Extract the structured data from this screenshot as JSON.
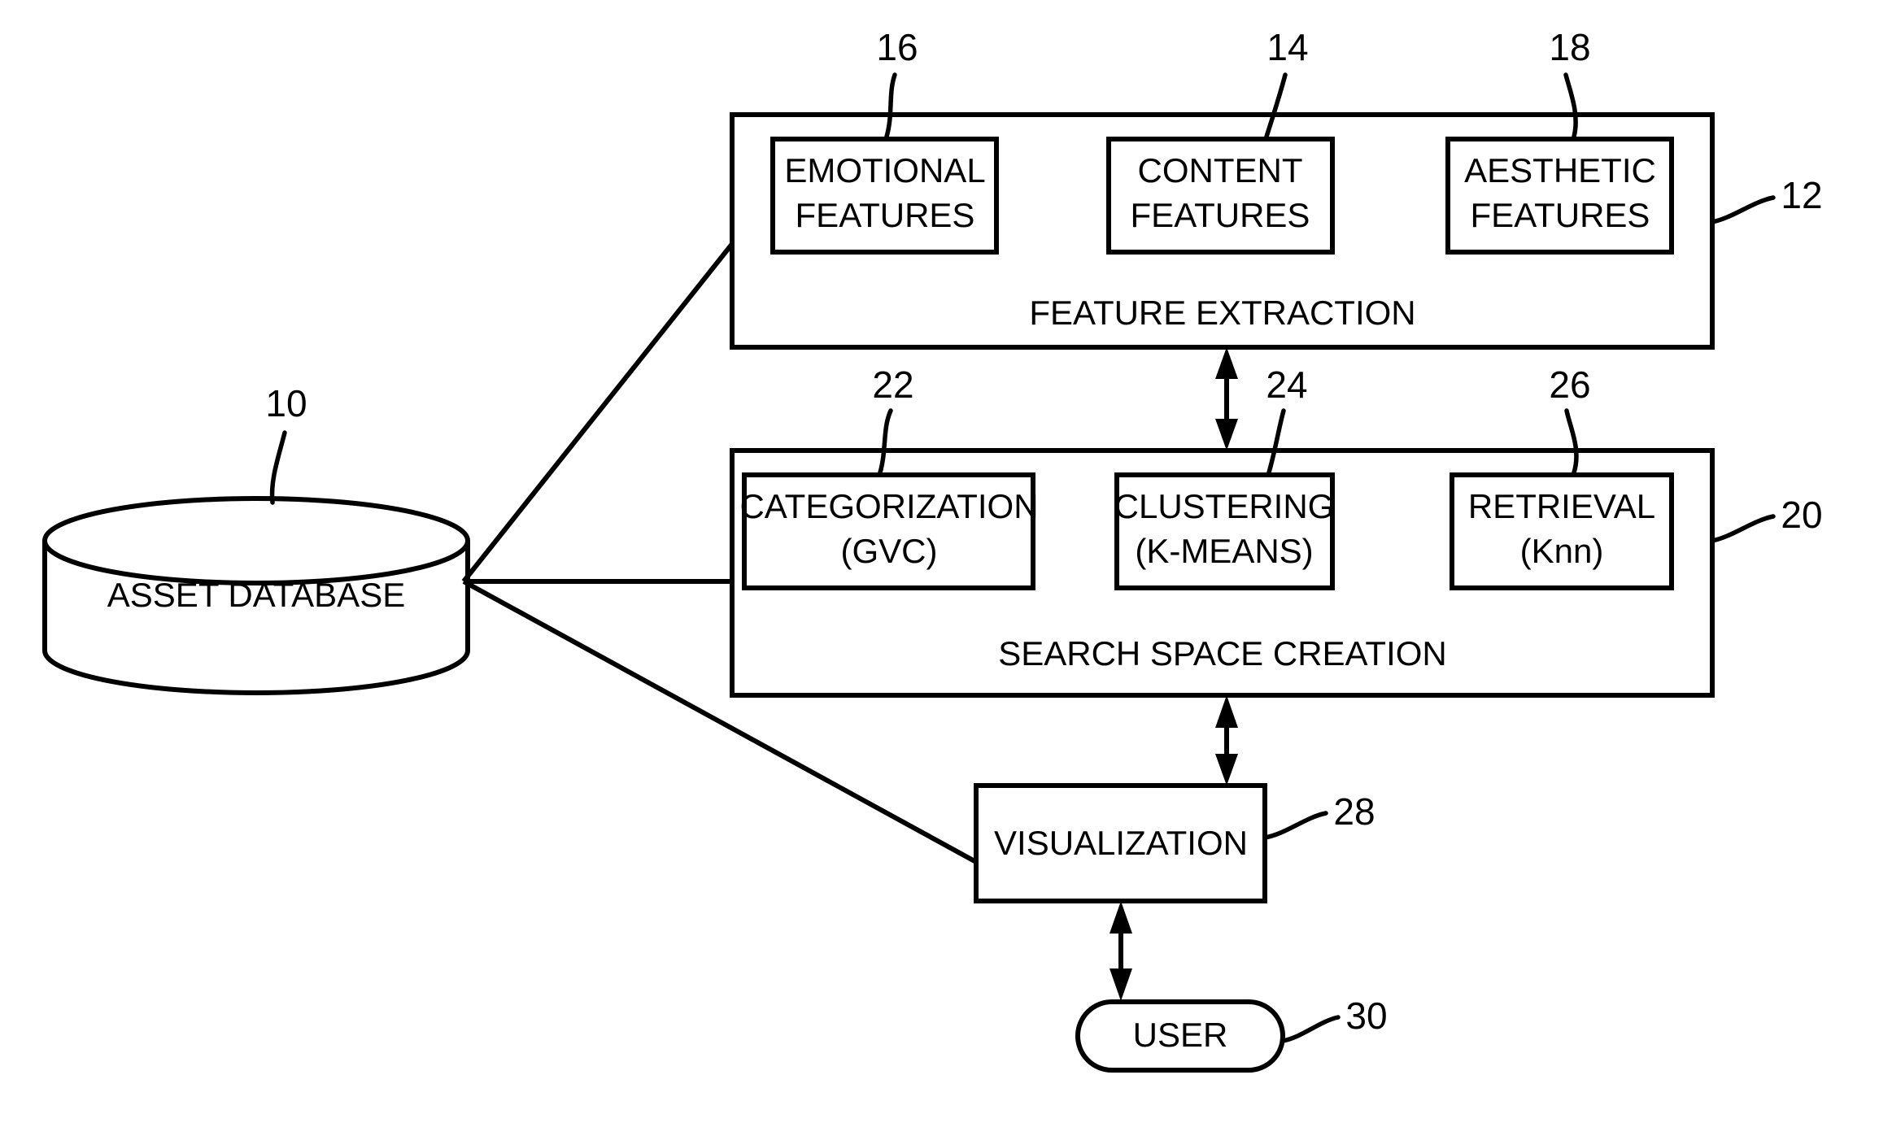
{
  "diagram": {
    "title": "Asset search system block diagram",
    "stroke_color": "#000000",
    "background_color": "#ffffff",
    "nodes": {
      "asset_database": {
        "label": "ASSET DATABASE",
        "ref": "10",
        "shape": "cylinder"
      },
      "feature_extraction": {
        "label": "FEATURE EXTRACTION",
        "ref": "12",
        "shape": "rectangle",
        "children": [
          {
            "label_line1": "EMOTIONAL",
            "label_line2": "FEATURES",
            "ref": "16"
          },
          {
            "label_line1": "CONTENT",
            "label_line2": "FEATURES",
            "ref": "14"
          },
          {
            "label_line1": "AESTHETIC",
            "label_line2": "FEATURES",
            "ref": "18"
          }
        ]
      },
      "search_space_creation": {
        "label": "SEARCH SPACE CREATION",
        "ref": "20",
        "shape": "rectangle",
        "children": [
          {
            "label_line1": "CATEGORIZATION",
            "label_line2": "(GVC)",
            "ref": "22"
          },
          {
            "label_line1": "CLUSTERING",
            "label_line2": "(K-MEANS)",
            "ref": "24"
          },
          {
            "label_line1": "RETRIEVAL",
            "label_line2": "(Knn)",
            "ref": "26"
          }
        ]
      },
      "visualization": {
        "label": "VISUALIZATION",
        "ref": "28",
        "shape": "rectangle"
      },
      "user": {
        "label": "USER",
        "ref": "30",
        "shape": "rounded-pill"
      }
    },
    "connections": [
      {
        "from": "asset_database",
        "to": "feature_extraction",
        "type": "line"
      },
      {
        "from": "asset_database",
        "to": "search_space_creation",
        "type": "line"
      },
      {
        "from": "asset_database",
        "to": "visualization",
        "type": "line"
      },
      {
        "from": "feature_extraction",
        "to": "search_space_creation",
        "type": "double-arrow"
      },
      {
        "from": "search_space_creation",
        "to": "visualization",
        "type": "double-arrow"
      },
      {
        "from": "visualization",
        "to": "user",
        "type": "double-arrow"
      }
    ]
  }
}
